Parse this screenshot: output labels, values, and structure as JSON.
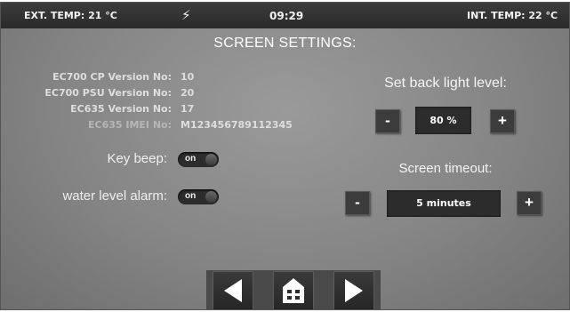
{
  "status_bar": {
    "ext_temp": "EXT. TEMP: 21 °C",
    "power_glyph": "⚡",
    "time": "09:29",
    "int_temp": "INT. TEMP: 22 °C"
  },
  "title": "SCREEN SETTINGS:",
  "versions": [
    {
      "label": "EC700 CP Version No:",
      "value": "10"
    },
    {
      "label": "EC700 PSU Version No:",
      "value": "20"
    },
    {
      "label": "EC635 Version No:",
      "value": "17"
    },
    {
      "label": "EC635 IMEI No:",
      "value": "M123456789112345"
    }
  ],
  "key_beep": {
    "label": "Key beep:",
    "state": "on"
  },
  "water_alarm": {
    "label": "water level alarm:",
    "state": "on"
  },
  "backlight": {
    "label": "Set back light level:",
    "value": "80 %",
    "minus": "-",
    "plus": "+"
  },
  "timeout": {
    "label": "Screen timeout:",
    "value": "5 minutes",
    "minus": "-",
    "plus": "+"
  },
  "nav": {
    "back_icon": "back-arrow-icon",
    "home_icon": "home-icon",
    "next_icon": "next-arrow-icon"
  },
  "colors": {
    "screen": "#858585",
    "status_bar": "#2e2e2e",
    "button": "#3c3c3c",
    "text": "#ffffff"
  }
}
